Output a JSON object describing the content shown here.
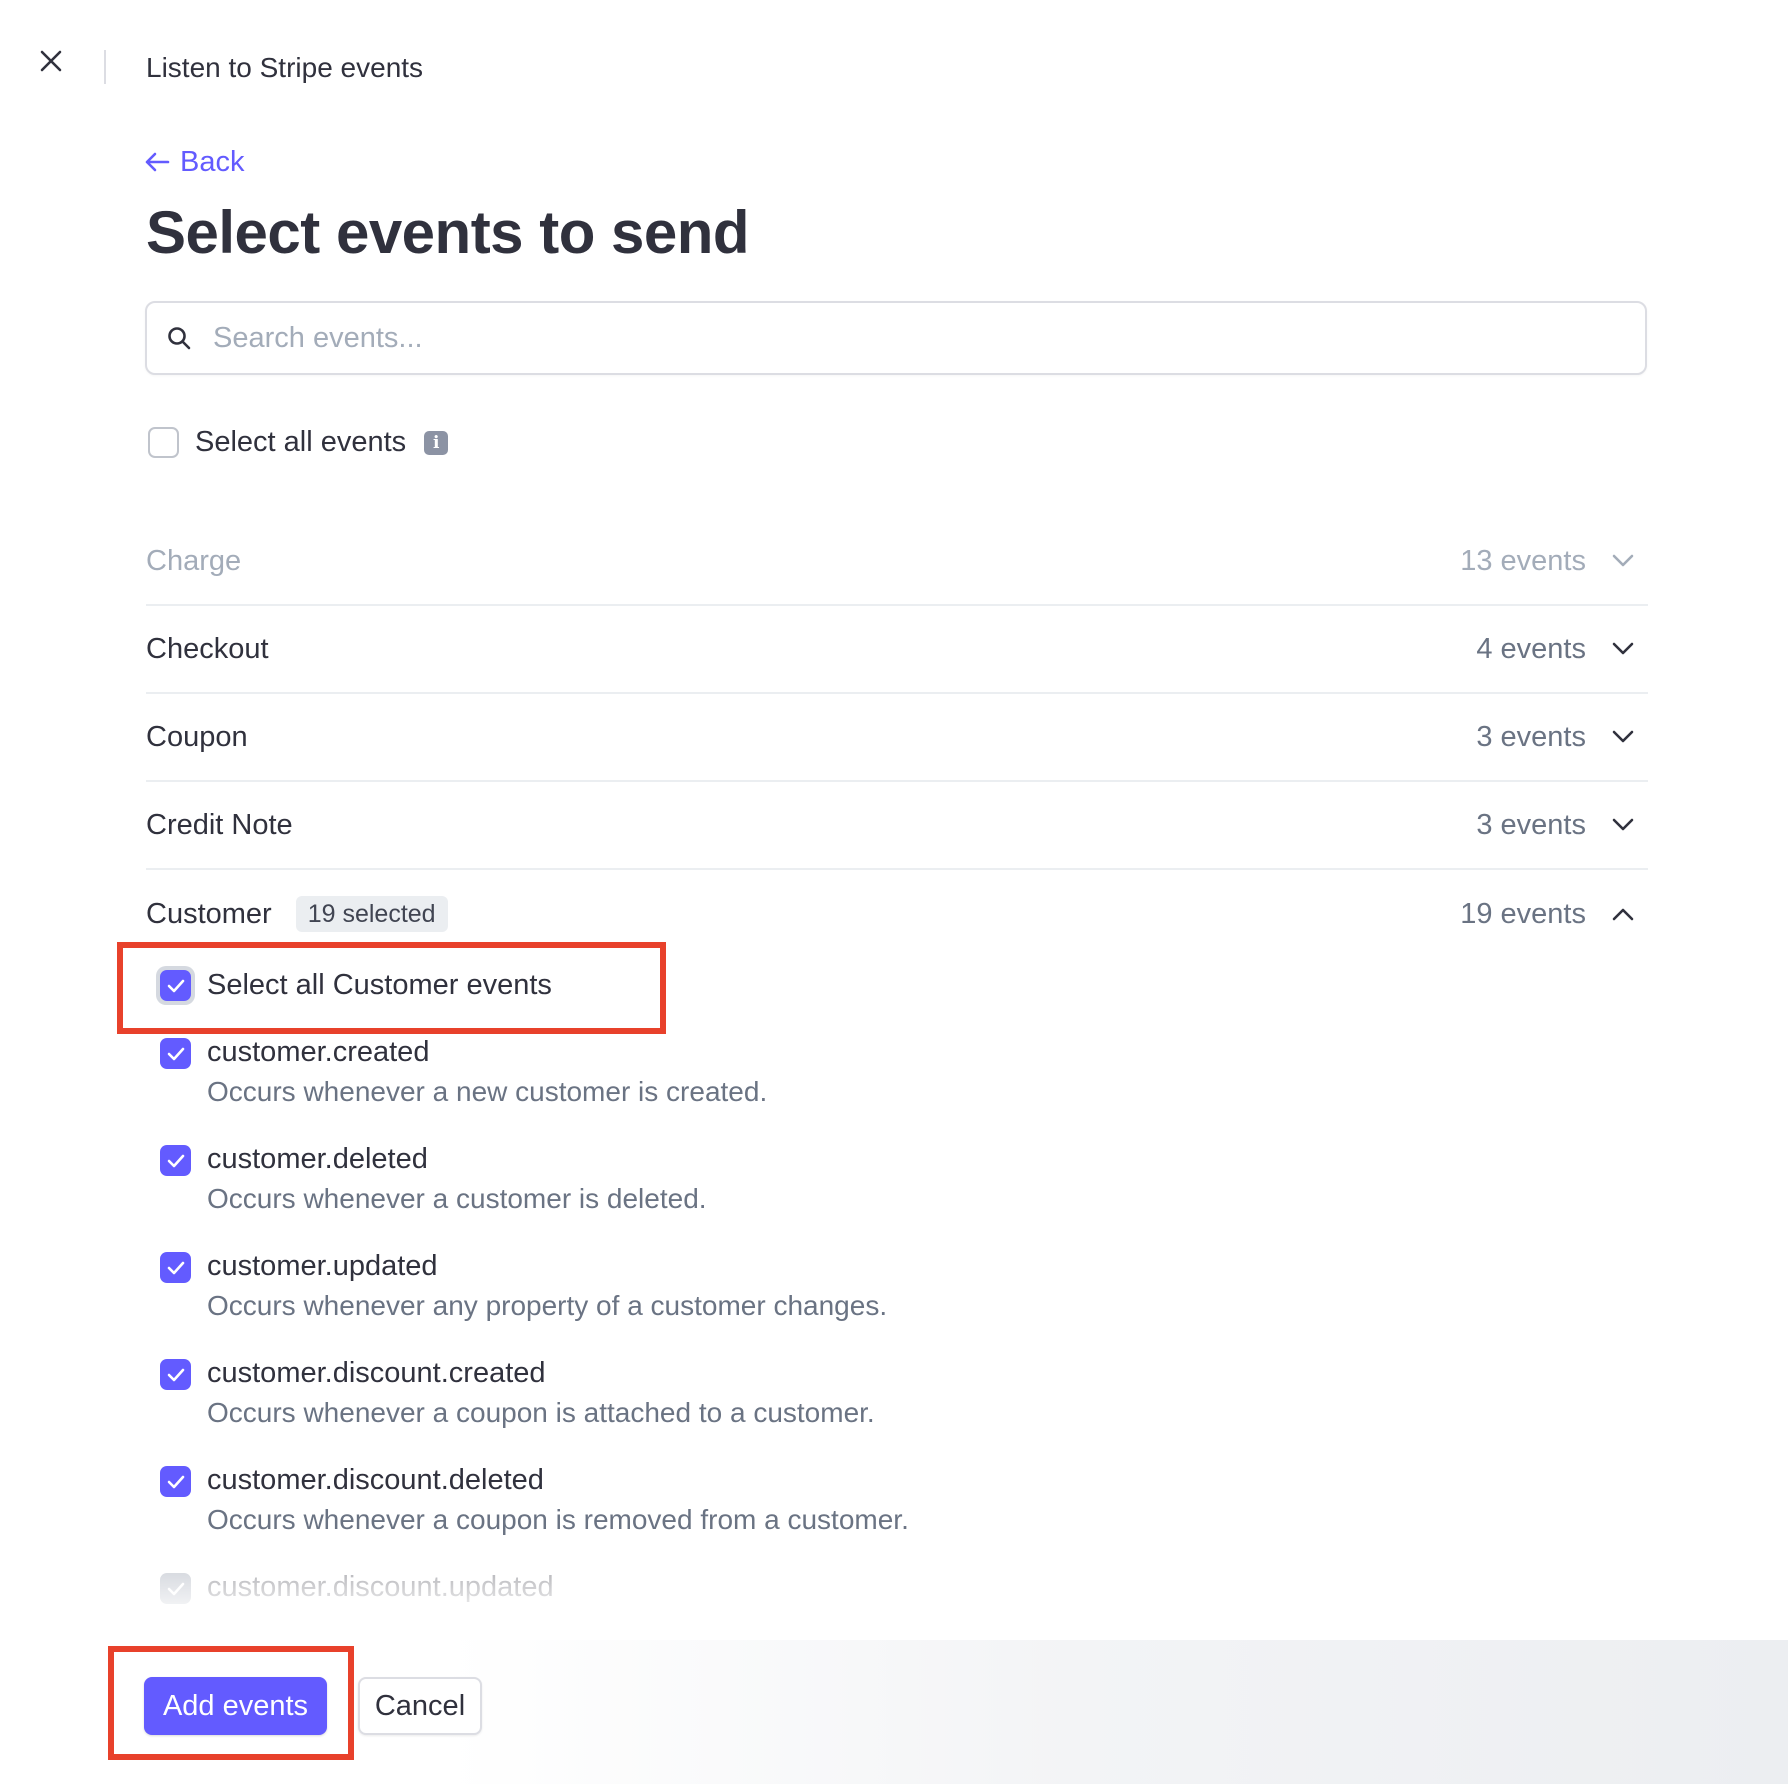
{
  "topbar": {
    "title": "Listen to Stripe events"
  },
  "back_label": "Back",
  "page_title": "Select events to send",
  "search": {
    "placeholder": "Search events...",
    "value": ""
  },
  "select_all": {
    "label": "Select all events",
    "checked": false
  },
  "categories": [
    {
      "name": "Charge",
      "count": "13 events",
      "expanded": false
    },
    {
      "name": "Checkout",
      "count": "4 events",
      "expanded": false
    },
    {
      "name": "Coupon",
      "count": "3 events",
      "expanded": false
    },
    {
      "name": "Credit Note",
      "count": "3 events",
      "expanded": false
    },
    {
      "name": "Customer",
      "count": "19 events",
      "badge": "19 selected",
      "expanded": true
    }
  ],
  "customer_section": {
    "select_all_label": "Select all Customer events",
    "events": [
      {
        "name": "customer.created",
        "description": "Occurs whenever a new customer is created.",
        "checked": true
      },
      {
        "name": "customer.deleted",
        "description": "Occurs whenever a customer is deleted.",
        "checked": true
      },
      {
        "name": "customer.updated",
        "description": "Occurs whenever any property of a customer changes.",
        "checked": true
      },
      {
        "name": "customer.discount.created",
        "description": "Occurs whenever a coupon is attached to a customer.",
        "checked": true
      },
      {
        "name": "customer.discount.deleted",
        "description": "Occurs whenever a coupon is removed from a customer.",
        "checked": true
      },
      {
        "name": "customer.discount.updated",
        "description": "",
        "checked": true
      }
    ]
  },
  "footer": {
    "add_label": "Add events",
    "cancel_label": "Cancel"
  },
  "colors": {
    "accent": "#635bff",
    "highlight": "#e8412b",
    "text": "#30313d",
    "muted": "#6a7383"
  }
}
